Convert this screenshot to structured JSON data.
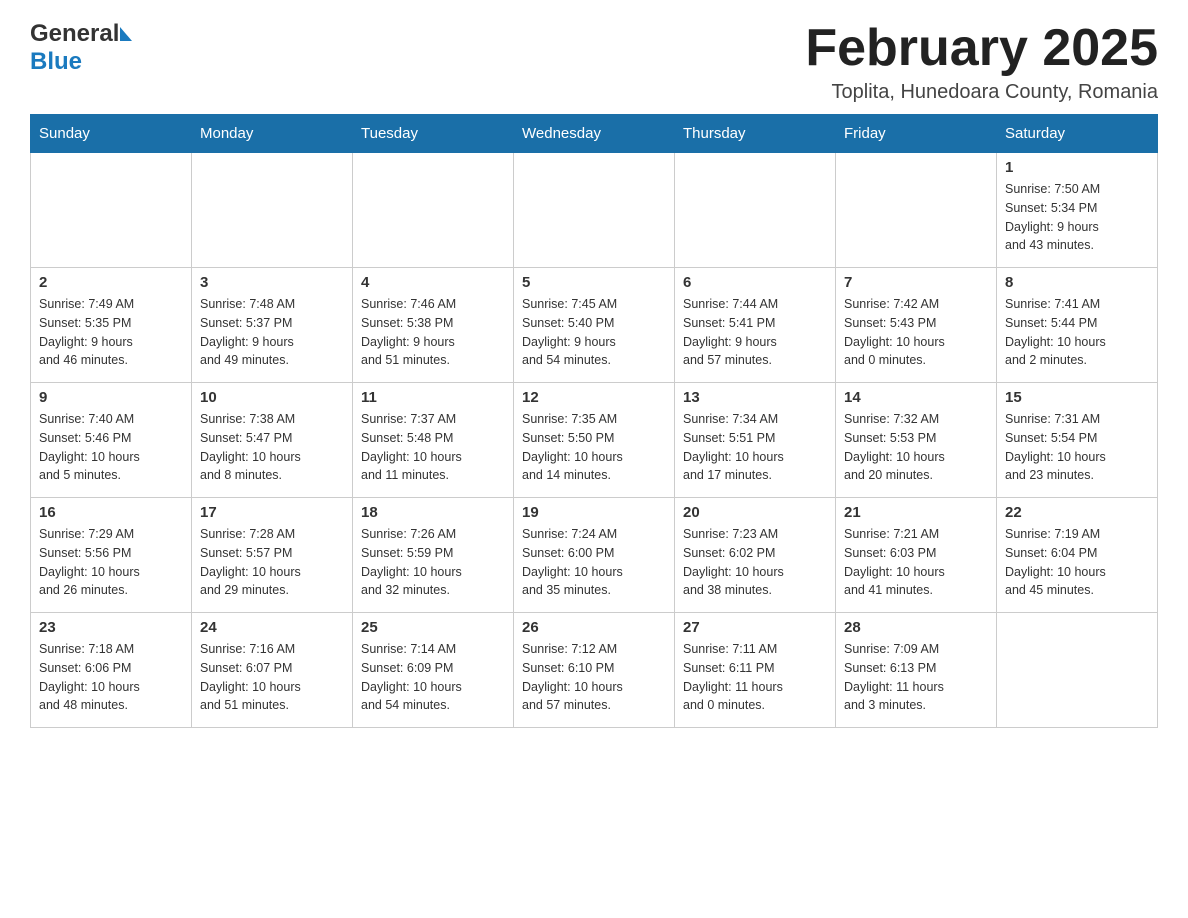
{
  "header": {
    "logo_general": "General",
    "logo_blue": "Blue",
    "month_title": "February 2025",
    "location": "Toplita, Hunedoara County, Romania"
  },
  "days_of_week": [
    "Sunday",
    "Monday",
    "Tuesday",
    "Wednesday",
    "Thursday",
    "Friday",
    "Saturday"
  ],
  "weeks": [
    {
      "days": [
        {
          "number": "",
          "info": ""
        },
        {
          "number": "",
          "info": ""
        },
        {
          "number": "",
          "info": ""
        },
        {
          "number": "",
          "info": ""
        },
        {
          "number": "",
          "info": ""
        },
        {
          "number": "",
          "info": ""
        },
        {
          "number": "1",
          "info": "Sunrise: 7:50 AM\nSunset: 5:34 PM\nDaylight: 9 hours\nand 43 minutes."
        }
      ]
    },
    {
      "days": [
        {
          "number": "2",
          "info": "Sunrise: 7:49 AM\nSunset: 5:35 PM\nDaylight: 9 hours\nand 46 minutes."
        },
        {
          "number": "3",
          "info": "Sunrise: 7:48 AM\nSunset: 5:37 PM\nDaylight: 9 hours\nand 49 minutes."
        },
        {
          "number": "4",
          "info": "Sunrise: 7:46 AM\nSunset: 5:38 PM\nDaylight: 9 hours\nand 51 minutes."
        },
        {
          "number": "5",
          "info": "Sunrise: 7:45 AM\nSunset: 5:40 PM\nDaylight: 9 hours\nand 54 minutes."
        },
        {
          "number": "6",
          "info": "Sunrise: 7:44 AM\nSunset: 5:41 PM\nDaylight: 9 hours\nand 57 minutes."
        },
        {
          "number": "7",
          "info": "Sunrise: 7:42 AM\nSunset: 5:43 PM\nDaylight: 10 hours\nand 0 minutes."
        },
        {
          "number": "8",
          "info": "Sunrise: 7:41 AM\nSunset: 5:44 PM\nDaylight: 10 hours\nand 2 minutes."
        }
      ]
    },
    {
      "days": [
        {
          "number": "9",
          "info": "Sunrise: 7:40 AM\nSunset: 5:46 PM\nDaylight: 10 hours\nand 5 minutes."
        },
        {
          "number": "10",
          "info": "Sunrise: 7:38 AM\nSunset: 5:47 PM\nDaylight: 10 hours\nand 8 minutes."
        },
        {
          "number": "11",
          "info": "Sunrise: 7:37 AM\nSunset: 5:48 PM\nDaylight: 10 hours\nand 11 minutes."
        },
        {
          "number": "12",
          "info": "Sunrise: 7:35 AM\nSunset: 5:50 PM\nDaylight: 10 hours\nand 14 minutes."
        },
        {
          "number": "13",
          "info": "Sunrise: 7:34 AM\nSunset: 5:51 PM\nDaylight: 10 hours\nand 17 minutes."
        },
        {
          "number": "14",
          "info": "Sunrise: 7:32 AM\nSunset: 5:53 PM\nDaylight: 10 hours\nand 20 minutes."
        },
        {
          "number": "15",
          "info": "Sunrise: 7:31 AM\nSunset: 5:54 PM\nDaylight: 10 hours\nand 23 minutes."
        }
      ]
    },
    {
      "days": [
        {
          "number": "16",
          "info": "Sunrise: 7:29 AM\nSunset: 5:56 PM\nDaylight: 10 hours\nand 26 minutes."
        },
        {
          "number": "17",
          "info": "Sunrise: 7:28 AM\nSunset: 5:57 PM\nDaylight: 10 hours\nand 29 minutes."
        },
        {
          "number": "18",
          "info": "Sunrise: 7:26 AM\nSunset: 5:59 PM\nDaylight: 10 hours\nand 32 minutes."
        },
        {
          "number": "19",
          "info": "Sunrise: 7:24 AM\nSunset: 6:00 PM\nDaylight: 10 hours\nand 35 minutes."
        },
        {
          "number": "20",
          "info": "Sunrise: 7:23 AM\nSunset: 6:02 PM\nDaylight: 10 hours\nand 38 minutes."
        },
        {
          "number": "21",
          "info": "Sunrise: 7:21 AM\nSunset: 6:03 PM\nDaylight: 10 hours\nand 41 minutes."
        },
        {
          "number": "22",
          "info": "Sunrise: 7:19 AM\nSunset: 6:04 PM\nDaylight: 10 hours\nand 45 minutes."
        }
      ]
    },
    {
      "days": [
        {
          "number": "23",
          "info": "Sunrise: 7:18 AM\nSunset: 6:06 PM\nDaylight: 10 hours\nand 48 minutes."
        },
        {
          "number": "24",
          "info": "Sunrise: 7:16 AM\nSunset: 6:07 PM\nDaylight: 10 hours\nand 51 minutes."
        },
        {
          "number": "25",
          "info": "Sunrise: 7:14 AM\nSunset: 6:09 PM\nDaylight: 10 hours\nand 54 minutes."
        },
        {
          "number": "26",
          "info": "Sunrise: 7:12 AM\nSunset: 6:10 PM\nDaylight: 10 hours\nand 57 minutes."
        },
        {
          "number": "27",
          "info": "Sunrise: 7:11 AM\nSunset: 6:11 PM\nDaylight: 11 hours\nand 0 minutes."
        },
        {
          "number": "28",
          "info": "Sunrise: 7:09 AM\nSunset: 6:13 PM\nDaylight: 11 hours\nand 3 minutes."
        },
        {
          "number": "",
          "info": ""
        }
      ]
    }
  ]
}
